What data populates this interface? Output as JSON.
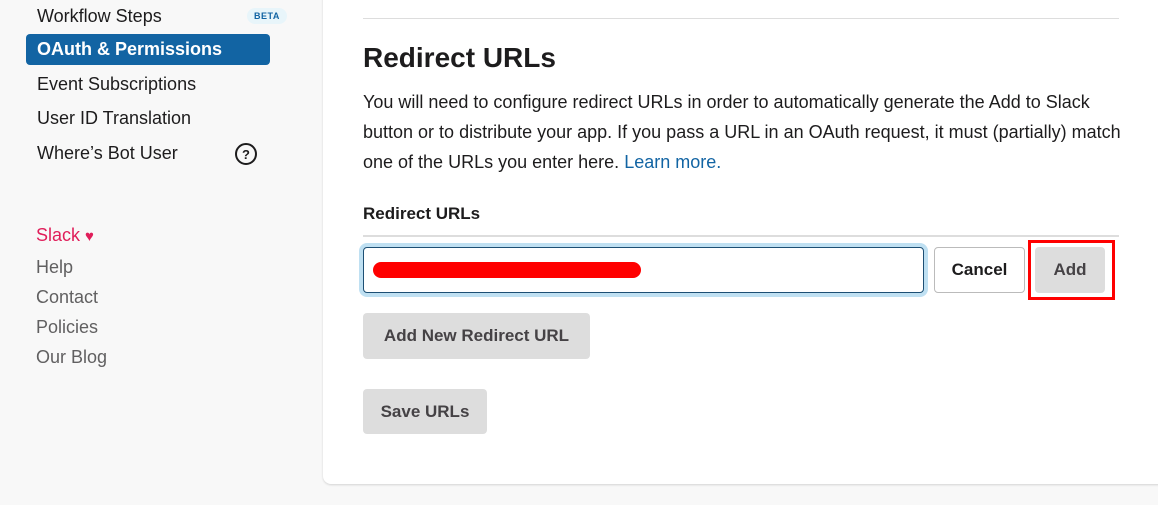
{
  "sidebar": {
    "items": [
      {
        "label": "Workflow Steps",
        "badge": "BETA",
        "active": false
      },
      {
        "label": "OAuth & Permissions",
        "active": true
      },
      {
        "label": "Event Subscriptions",
        "active": false
      },
      {
        "label": "User ID Translation",
        "active": false
      },
      {
        "label": "Where’s Bot User",
        "icon": "help-circle-icon",
        "active": false
      }
    ],
    "help_icon_glyph": "?",
    "footer": {
      "slack": "Slack",
      "heart": "♥",
      "links": [
        "Help",
        "Contact",
        "Policies",
        "Our Blog"
      ]
    }
  },
  "main": {
    "title": "Redirect URLs",
    "description": "You will need to configure redirect URLs in order to automatically generate the Add to Slack button or to distribute your app. If you pass a URL in an OAuth request, it must (partially) match one of the URLs you enter here.",
    "learn_more": "Learn more.",
    "field_label": "Redirect URLs",
    "input_value": "",
    "buttons": {
      "cancel": "Cancel",
      "add": "Add",
      "add_new": "Add New Redirect URL",
      "save": "Save URLs"
    },
    "annotation_color": "#ff0000"
  },
  "colors": {
    "accent": "#1264a3",
    "slack_pink": "#e01e5a",
    "button_gray": "#dddddd"
  }
}
